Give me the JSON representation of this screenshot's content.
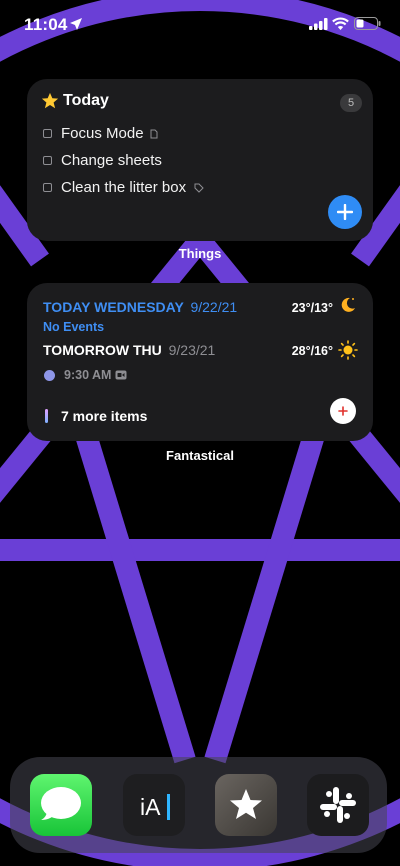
{
  "status_bar": {
    "time": "11:04"
  },
  "widgets": {
    "things": {
      "title": "Today",
      "count": "5",
      "todos": [
        {
          "label": "Focus Mode",
          "meta_icon": "note-icon"
        },
        {
          "label": "Change sheets",
          "meta_icon": ""
        },
        {
          "label": "Clean the litter box",
          "meta_icon": "tag-icon"
        }
      ],
      "caption": "Things"
    },
    "fantastical": {
      "today_label": "TODAY WEDNESDAY",
      "today_date": "9/22/21",
      "today_temp": "23°/13°",
      "no_events": "No Events",
      "tomorrow_label": "TOMORROW THU",
      "tomorrow_date": "9/23/21",
      "tomorrow_temp": "28°/16°",
      "event_time": "9:30 AM",
      "more_items": "7 more items",
      "caption": "Fantastical"
    }
  },
  "dock": {
    "apps": [
      "Messages",
      "iA Writer",
      "Reeder",
      "Slack"
    ],
    "ia_label": "iA"
  },
  "colors": {
    "wallpaper_lines": "#6a3fd6",
    "accent_blue": "#3f8ef3",
    "things_button": "#2f8cf5"
  }
}
